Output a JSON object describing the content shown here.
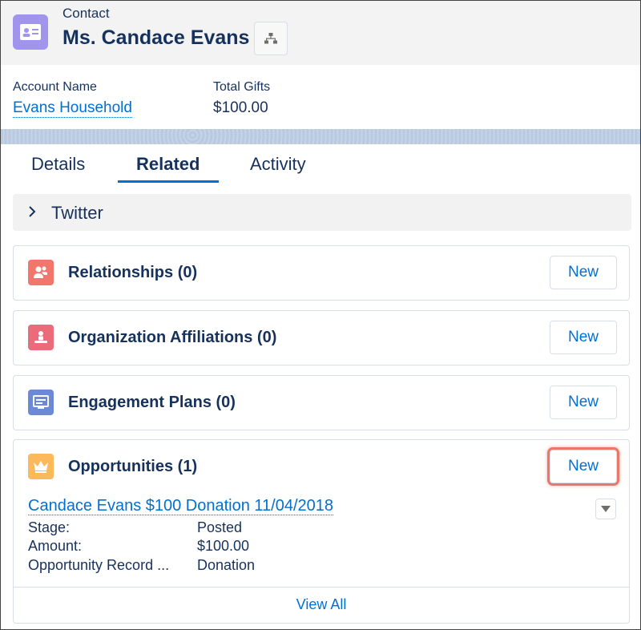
{
  "header": {
    "object_label": "Contact",
    "record_name": "Ms. Candace Evans",
    "icon": "contact-card-icon",
    "hierarchy_icon": "hierarchy-icon",
    "icon_color": "#a094ed"
  },
  "highlights": {
    "account_label": "Account Name",
    "account_value": "Evans Household",
    "gifts_label": "Total Gifts",
    "gifts_value": "$100.00"
  },
  "tabs": [
    {
      "label": "Details",
      "active": false
    },
    {
      "label": "Related",
      "active": true
    },
    {
      "label": "Activity",
      "active": false
    }
  ],
  "twitter": {
    "label": "Twitter",
    "icon": "chevron-right-icon"
  },
  "related_lists": [
    {
      "title": "Relationships (0)",
      "icon": "relationship-icon",
      "icon_color": "#f2766b",
      "new_label": "New"
    },
    {
      "title": "Organization Affiliations (0)",
      "icon": "affiliation-icon",
      "icon_color": "#ea6c7b",
      "new_label": "New"
    },
    {
      "title": "Engagement Plans (0)",
      "icon": "engagement-plan-icon",
      "icon_color": "#6b89d7",
      "new_label": "New"
    },
    {
      "title": "Opportunities (1)",
      "icon": "opportunity-crown-icon",
      "icon_color": "#fcb95b",
      "new_label": "New",
      "record": {
        "name": "Candace Evans $100 Donation 11/04/2018",
        "fields": [
          {
            "label": "Stage:",
            "value": "Posted"
          },
          {
            "label": "Amount:",
            "value": "$100.00"
          },
          {
            "label": "Opportunity Record ...",
            "value": "Donation"
          }
        ]
      },
      "view_all": "View All"
    }
  ],
  "colors": {
    "link": "#0070d2",
    "text": "#16325c",
    "highlight_ring": "#e8786a"
  }
}
